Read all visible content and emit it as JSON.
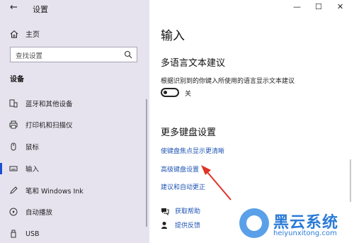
{
  "window": {
    "title": "设置",
    "back_icon": "arrow-left-icon",
    "controls": [
      "—",
      "☐",
      "✕"
    ]
  },
  "sidebar": {
    "home_label": "主页",
    "search_placeholder": "查找设置",
    "section_title": "设备",
    "items": [
      {
        "label": "蓝牙和其他设备",
        "icon": "bluetooth-devices-icon",
        "active": false
      },
      {
        "label": "打印机和扫描仪",
        "icon": "printer-icon",
        "active": false
      },
      {
        "label": "鼠标",
        "icon": "mouse-icon",
        "active": false
      },
      {
        "label": "输入",
        "icon": "keyboard-icon",
        "active": true
      },
      {
        "label": "笔和 Windows Ink",
        "icon": "pen-icon",
        "active": false
      },
      {
        "label": "自动播放",
        "icon": "autoplay-icon",
        "active": false
      },
      {
        "label": "USB",
        "icon": "usb-icon",
        "active": false
      }
    ]
  },
  "main": {
    "title": "输入",
    "multilang": {
      "heading": "多语言文本建议",
      "description": "根据识别到的你键入所使用的语言显示文本建议",
      "toggle_state": "关",
      "toggle_on": false
    },
    "more_keyboard": {
      "heading": "更多键盘设置",
      "links": [
        "使键盘焦点显示更清晰",
        "高级键盘设置",
        "建议和自动更正"
      ]
    },
    "help": {
      "get_help": "获取帮助",
      "feedback": "提供反馈"
    }
  },
  "watermark": {
    "name": "黑云系统",
    "url": "heiyunxitong.com"
  },
  "colors": {
    "sidebar_bg": "#e6e3ee",
    "link": "#1f55b5",
    "accent": "#1c4fd0",
    "arrow": "#e0342a"
  }
}
